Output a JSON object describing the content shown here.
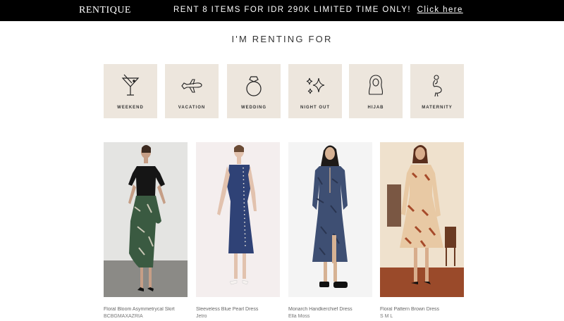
{
  "header": {
    "logo": "RENTIQUE",
    "promo_text": "RENT 8 ITEMS FOR IDR 290K LIMITED TIME ONLY!",
    "promo_link": "Click here"
  },
  "section_title": "I'M RENTING FOR",
  "occasions": [
    {
      "label": "WEEKEND",
      "icon": "cocktail-icon"
    },
    {
      "label": "VACATION",
      "icon": "airplane-icon"
    },
    {
      "label": "WEDDING",
      "icon": "ring-icon"
    },
    {
      "label": "NIGHT OUT",
      "icon": "sparkles-icon"
    },
    {
      "label": "HIJAB",
      "icon": "hijab-icon"
    },
    {
      "label": "MATERNITY",
      "icon": "maternity-icon"
    }
  ],
  "colors": {
    "tile_background": "#ede6dd",
    "topbar": "#000000"
  },
  "products": [
    {
      "name": "Floral Bloom Asymmetrycal  Skirt",
      "brand": "BCBGMAXAZRIA"
    },
    {
      "name": "Sleeveless Blue Pearl Dress",
      "brand": "Jetro"
    },
    {
      "name": "Monarch Handkerchief Dress",
      "brand": "Ella Moss"
    },
    {
      "name": "Floral Pattern Brown Dress",
      "brand": "S M L"
    }
  ]
}
